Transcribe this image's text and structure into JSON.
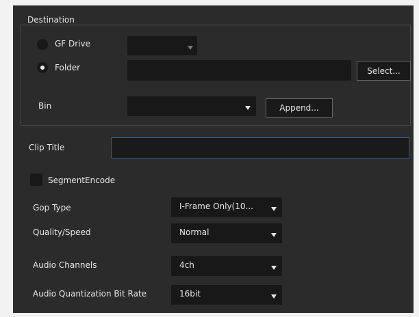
{
  "destination": {
    "group_title": "Destination",
    "gf_drive": {
      "label": "GF Drive",
      "selected": false,
      "drive_value": ""
    },
    "folder": {
      "label": "Folder",
      "selected": true,
      "path_value": "",
      "select_button": "Select..."
    },
    "bin": {
      "label": "Bin",
      "value": "",
      "append_button": "Append..."
    }
  },
  "clip_title": {
    "label": "Clip Title",
    "value": ""
  },
  "segment_encode": {
    "label": "SegmentEncode",
    "checked": false
  },
  "gop_type": {
    "label": "Gop Type",
    "value": "I-Frame Only(10..."
  },
  "quality_speed": {
    "label": "Quality/Speed",
    "value": "Normal"
  },
  "audio_channels": {
    "label": "Audio Channels",
    "value": "4ch"
  },
  "audio_quant_bit_rate": {
    "label": "Audio Quantization Bit Rate",
    "value": "16bit"
  },
  "colors": {
    "panel_bg": "#2b2b2b",
    "field_bg": "#181818",
    "focus_border": "#2f5f8f",
    "text": "#e6e6e6"
  },
  "icons": [
    "radio-unchecked-icon",
    "radio-checked-icon",
    "chevron-down-icon",
    "checkbox-icon"
  ]
}
